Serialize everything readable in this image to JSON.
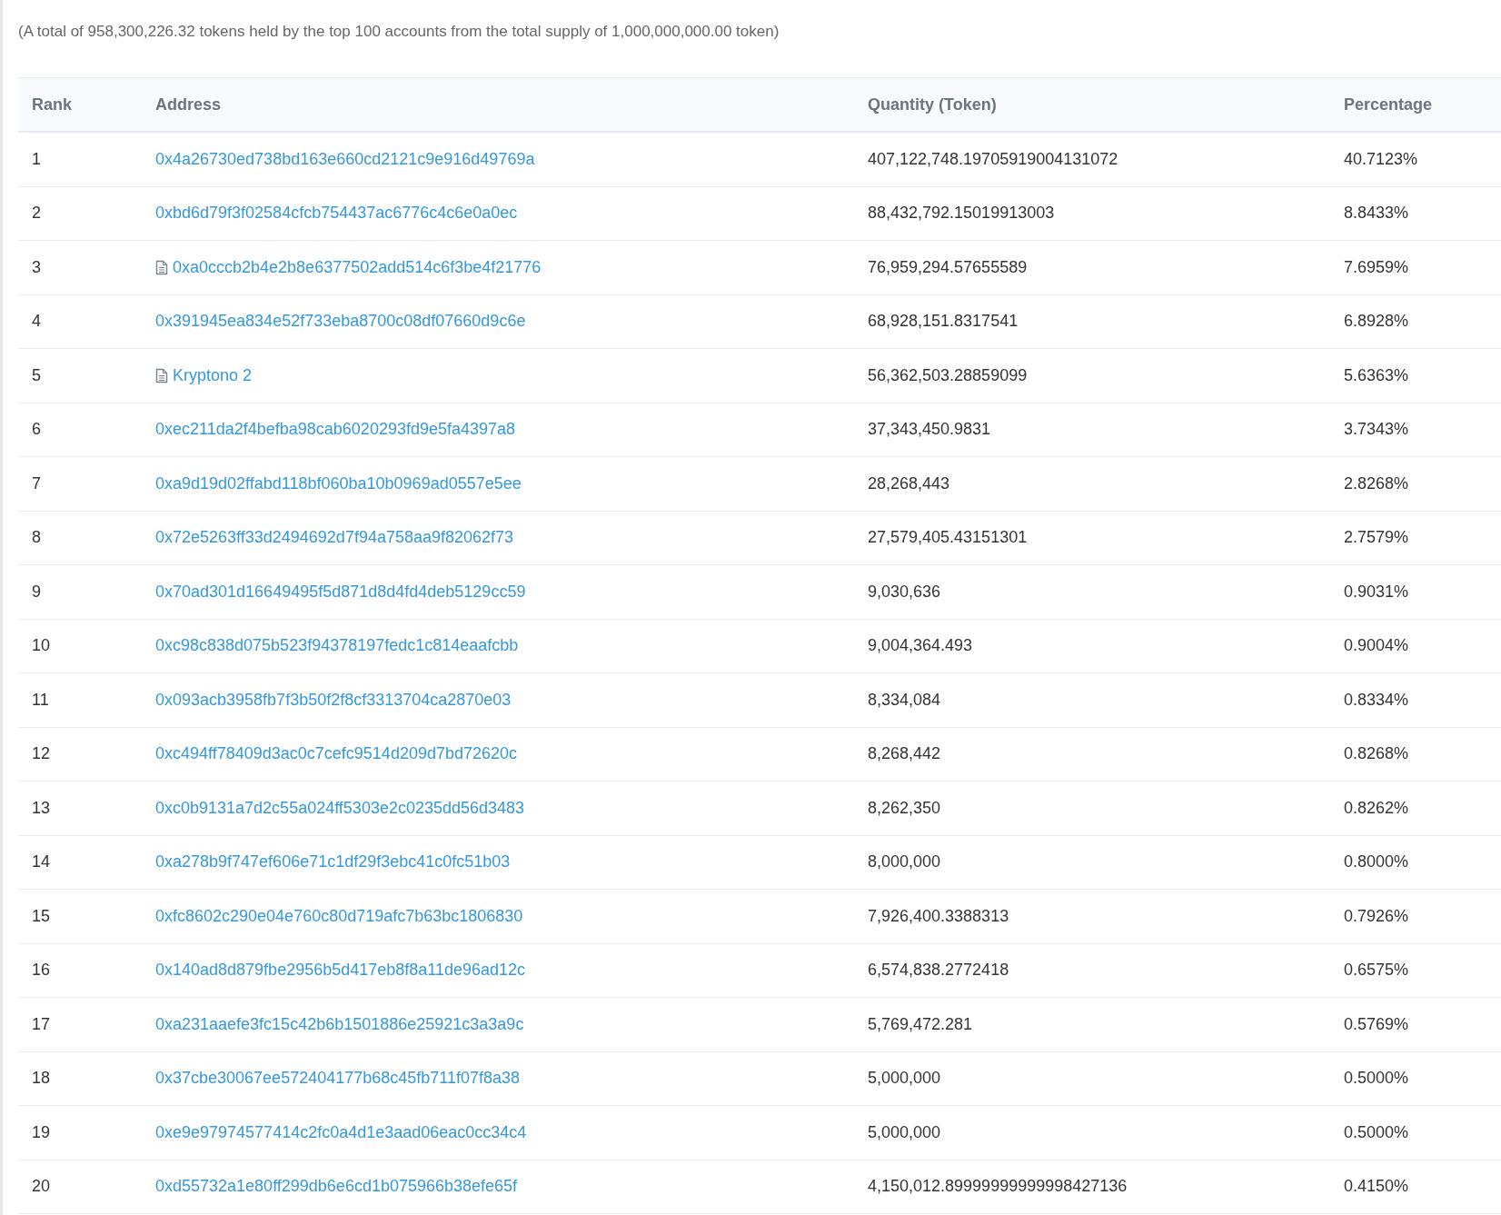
{
  "summary": "(A total of 958,300,226.32 tokens held by the top 100 accounts from the total supply of 1,000,000,000.00 token)",
  "table": {
    "columns": [
      "Rank",
      "Address",
      "Quantity (Token)",
      "Percentage"
    ],
    "rows": [
      {
        "rank": "1",
        "kind": "address",
        "address": "0x4a26730ed738bd163e660cd2121c9e916d49769a",
        "quantity": "407,122,748.19705919004131072",
        "percentage": "40.7123%"
      },
      {
        "rank": "2",
        "kind": "address",
        "address": "0xbd6d79f3f02584cfcb754437ac6776c4c6e0a0ec",
        "quantity": "88,432,792.15019913003",
        "percentage": "8.8433%"
      },
      {
        "rank": "3",
        "kind": "contract",
        "address": "0xa0cccb2b4e2b8e6377502add514c6f3be4f21776",
        "quantity": "76,959,294.57655589",
        "percentage": "7.6959%"
      },
      {
        "rank": "4",
        "kind": "address",
        "address": "0x391945ea834e52f733eba8700c08df07660d9c6e",
        "quantity": "68,928,151.8317541",
        "percentage": "6.8928%"
      },
      {
        "rank": "5",
        "kind": "contract",
        "address": "Kryptono 2",
        "quantity": "56,362,503.28859099",
        "percentage": "5.6363%"
      },
      {
        "rank": "6",
        "kind": "address",
        "address": "0xec211da2f4befba98cab6020293fd9e5fa4397a8",
        "quantity": "37,343,450.9831",
        "percentage": "3.7343%"
      },
      {
        "rank": "7",
        "kind": "address",
        "address": "0xa9d19d02ffabd118bf060ba10b0969ad0557e5ee",
        "quantity": "28,268,443",
        "percentage": "2.8268%"
      },
      {
        "rank": "8",
        "kind": "address",
        "address": "0x72e5263ff33d2494692d7f94a758aa9f82062f73",
        "quantity": "27,579,405.43151301",
        "percentage": "2.7579%"
      },
      {
        "rank": "9",
        "kind": "address",
        "address": "0x70ad301d16649495f5d871d8d4fd4deb5129cc59",
        "quantity": "9,030,636",
        "percentage": "0.9031%"
      },
      {
        "rank": "10",
        "kind": "address",
        "address": "0xc98c838d075b523f94378197fedc1c814eaafcbb",
        "quantity": "9,004,364.493",
        "percentage": "0.9004%"
      },
      {
        "rank": "11",
        "kind": "address",
        "address": "0x093acb3958fb7f3b50f2f8cf3313704ca2870e03",
        "quantity": "8,334,084",
        "percentage": "0.8334%"
      },
      {
        "rank": "12",
        "kind": "address",
        "address": "0xc494ff78409d3ac0c7cefc9514d209d7bd72620c",
        "quantity": "8,268,442",
        "percentage": "0.8268%"
      },
      {
        "rank": "13",
        "kind": "address",
        "address": "0xc0b9131a7d2c55a024ff5303e2c0235dd56d3483",
        "quantity": "8,262,350",
        "percentage": "0.8262%"
      },
      {
        "rank": "14",
        "kind": "address",
        "address": "0xa278b9f747ef606e71c1df29f3ebc41c0fc51b03",
        "quantity": "8,000,000",
        "percentage": "0.8000%"
      },
      {
        "rank": "15",
        "kind": "address",
        "address": "0xfc8602c290e04e760c80d719afc7b63bc1806830",
        "quantity": "7,926,400.3388313",
        "percentage": "0.7926%"
      },
      {
        "rank": "16",
        "kind": "address",
        "address": "0x140ad8d879fbe2956b5d417eb8f8a11de96ad12c",
        "quantity": "6,574,838.2772418",
        "percentage": "0.6575%"
      },
      {
        "rank": "17",
        "kind": "address",
        "address": "0xa231aaefe3fc15c42b6b1501886e25921c3a3a9c",
        "quantity": "5,769,472.281",
        "percentage": "0.5769%"
      },
      {
        "rank": "18",
        "kind": "address",
        "address": "0x37cbe30067ee572404177b68c45fb711f07f8a38",
        "quantity": "5,000,000",
        "percentage": "0.5000%"
      },
      {
        "rank": "19",
        "kind": "address",
        "address": "0xe9e97974577414c2fc0a4d1e3aad06eac0cc34c4",
        "quantity": "5,000,000",
        "percentage": "0.5000%"
      },
      {
        "rank": "20",
        "kind": "address",
        "address": "0xd55732a1e80ff299db6e6cd1b075966b38efe65f",
        "quantity": "4,150,012.89999999999998427136",
        "percentage": "0.4150%"
      }
    ]
  }
}
